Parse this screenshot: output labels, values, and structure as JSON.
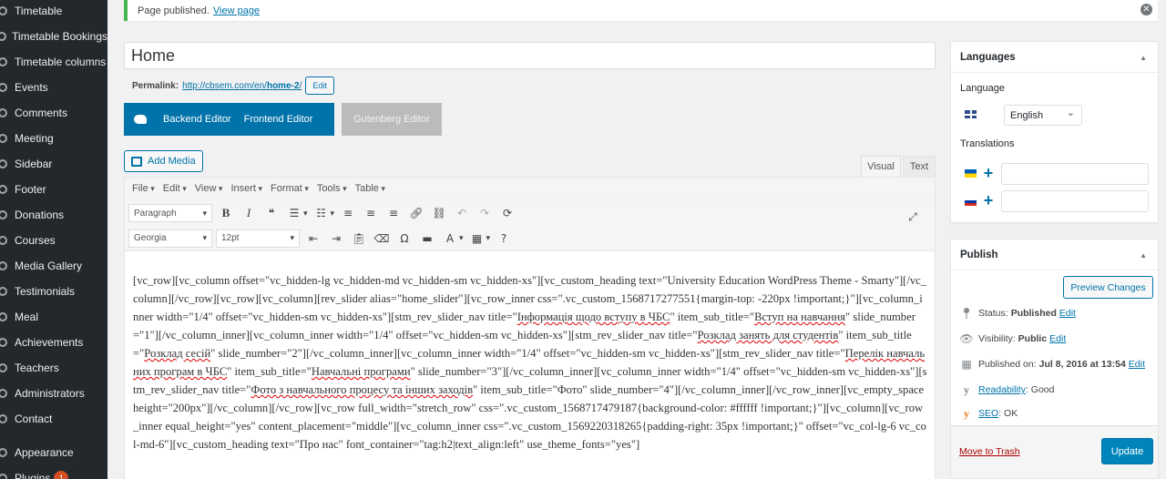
{
  "sidebar": {
    "items": [
      {
        "label": "Timetable",
        "icon": "gear-icon"
      },
      {
        "label": "Timetable Bookings",
        "icon": "gear-icon"
      },
      {
        "label": "Timetable columns",
        "icon": "gear-icon"
      },
      {
        "label": "Events",
        "icon": "pin-icon"
      },
      {
        "label": "Comments",
        "icon": "comment-icon"
      },
      {
        "label": "Meeting",
        "icon": "pin-icon"
      },
      {
        "label": "Sidebar",
        "icon": "pin-icon"
      },
      {
        "label": "Footer",
        "icon": "pin-icon"
      },
      {
        "label": "Donations",
        "icon": "pin-icon"
      },
      {
        "label": "Courses",
        "icon": "pin-icon"
      },
      {
        "label": "Media Gallery",
        "icon": "pin-icon"
      },
      {
        "label": "Testimonials",
        "icon": "pin-icon"
      },
      {
        "label": "Meal",
        "icon": "pin-icon"
      },
      {
        "label": "Achievements",
        "icon": "pin-icon"
      },
      {
        "label": "Teachers",
        "icon": "pin-icon"
      },
      {
        "label": "Administrators",
        "icon": "pin-icon"
      },
      {
        "label": "Contact",
        "icon": "pin-icon"
      },
      {
        "label": "Appearance",
        "icon": "brush-icon"
      },
      {
        "label": "Plugins",
        "icon": "plugin-icon",
        "badge": "1"
      }
    ]
  },
  "notice": {
    "text": "Page published.",
    "link": "View page"
  },
  "post": {
    "title": "Home",
    "permalink_label": "Permalink:",
    "permalink_base": "http://cbsem.com/en/",
    "permalink_slug": "home-2",
    "permalink_trail": "/",
    "edit_label": "Edit"
  },
  "composer": {
    "backend": "Backend Editor",
    "frontend": "Frontend Editor",
    "gutenberg": "Gutenberg Editor"
  },
  "editor": {
    "add_media": "Add Media",
    "tab_visual": "Visual",
    "tab_text": "Text",
    "menus": [
      "File",
      "Edit",
      "View",
      "Insert",
      "Format",
      "Tools",
      "Table"
    ],
    "format_select": "Paragraph",
    "font_select": "Georgia",
    "size_select": "12pt",
    "content": [
      {
        "t": "[vc_row][vc_column offset=\"vc_hidden-lg vc_hidden-md vc_hidden-sm vc_hidden-xs\"][vc_custom_heading text=\"University Education WordPress Theme - Smarty\"][/vc_column][/vc_row][vc_row][vc_column][rev_slider alias=\"home_slider\"][vc_row_inner css=\".vc_custom_1568717277551{margin-top: -220px !important;}\"][vc_column_inner width=\"1/4\" offset=\"vc_hidden-sm vc_hidden-xs\"][stm_rev_slider_nav title=\""
      },
      {
        "t": "Інформація щодо вступу в ЧБС",
        "s": true
      },
      {
        "t": "\" item_sub_title=\""
      },
      {
        "t": "Вступ на навчання",
        "s": true
      },
      {
        "t": "\" slide_number=\"1\"][/vc_column_inner][vc_column_inner width=\"1/4\" offset=\"vc_hidden-sm vc_hidden-xs\"][stm_rev_slider_nav title=\""
      },
      {
        "t": "Розклад занять для студентів",
        "s": true
      },
      {
        "t": "\" item_sub_title=\""
      },
      {
        "t": "Розклад сесій",
        "s": true
      },
      {
        "t": "\" slide_number=\"2\"][/vc_column_inner][vc_column_inner width=\"1/4\" offset=\"vc_hidden-sm vc_hidden-xs\"][stm_rev_slider_nav title=\""
      },
      {
        "t": "Перелік навчальних програм в ЧБС",
        "s": true
      },
      {
        "t": "\" item_sub_title=\""
      },
      {
        "t": "Навчальні програми",
        "s": true
      },
      {
        "t": "\" slide_number=\"3\"][/vc_column_inner][vc_column_inner width=\"1/4\" offset=\"vc_hidden-sm vc_hidden-xs\"][stm_rev_slider_nav title=\""
      },
      {
        "t": "Фото з навчального процесу та інших заходів",
        "s": true
      },
      {
        "t": "\" item_sub_title=\"Фото\" slide_number=\"4\"][/vc_column_inner][/vc_row_inner][vc_empty_space height=\"200px\"][/vc_column][/vc_row][vc_row full_width=\"stretch_row\" css=\".vc_custom_1568717479187{background-color: #ffffff !important;}\"][vc_column][vc_row_inner equal_height=\"yes\" content_placement=\"middle\"][vc_column_inner css=\".vc_custom_1569220318265{padding-right: 35px !important;}\" offset=\"vc_col-lg-6 vc_col-md-6\"][vc_custom_heading text=\"Про нас\" font_container=\"tag:h2|text_align:left\" use_theme_fonts=\"yes\"]"
      }
    ]
  },
  "languages": {
    "title": "Languages",
    "language_label": "Language",
    "language_value": "English",
    "translations_label": "Translations"
  },
  "publish": {
    "title": "Publish",
    "preview": "Preview Changes",
    "status_label": "Status:",
    "status_value": "Published",
    "visibility_label": "Visibility:",
    "visibility_value": "Public",
    "published_label": "Published on:",
    "published_value": "Jul 8, 2016 at 13:54",
    "edit": "Edit",
    "readability_label": "Readability",
    "readability_value": ": Good",
    "seo_label": "SEO",
    "seo_value": ": OK",
    "trash": "Move to Trash",
    "update": "Update"
  },
  "colors": {
    "accent": "#0073aa",
    "sidebar_bg": "#23282d",
    "update_btn": "#0085ba",
    "notice_border": "#46b450"
  }
}
